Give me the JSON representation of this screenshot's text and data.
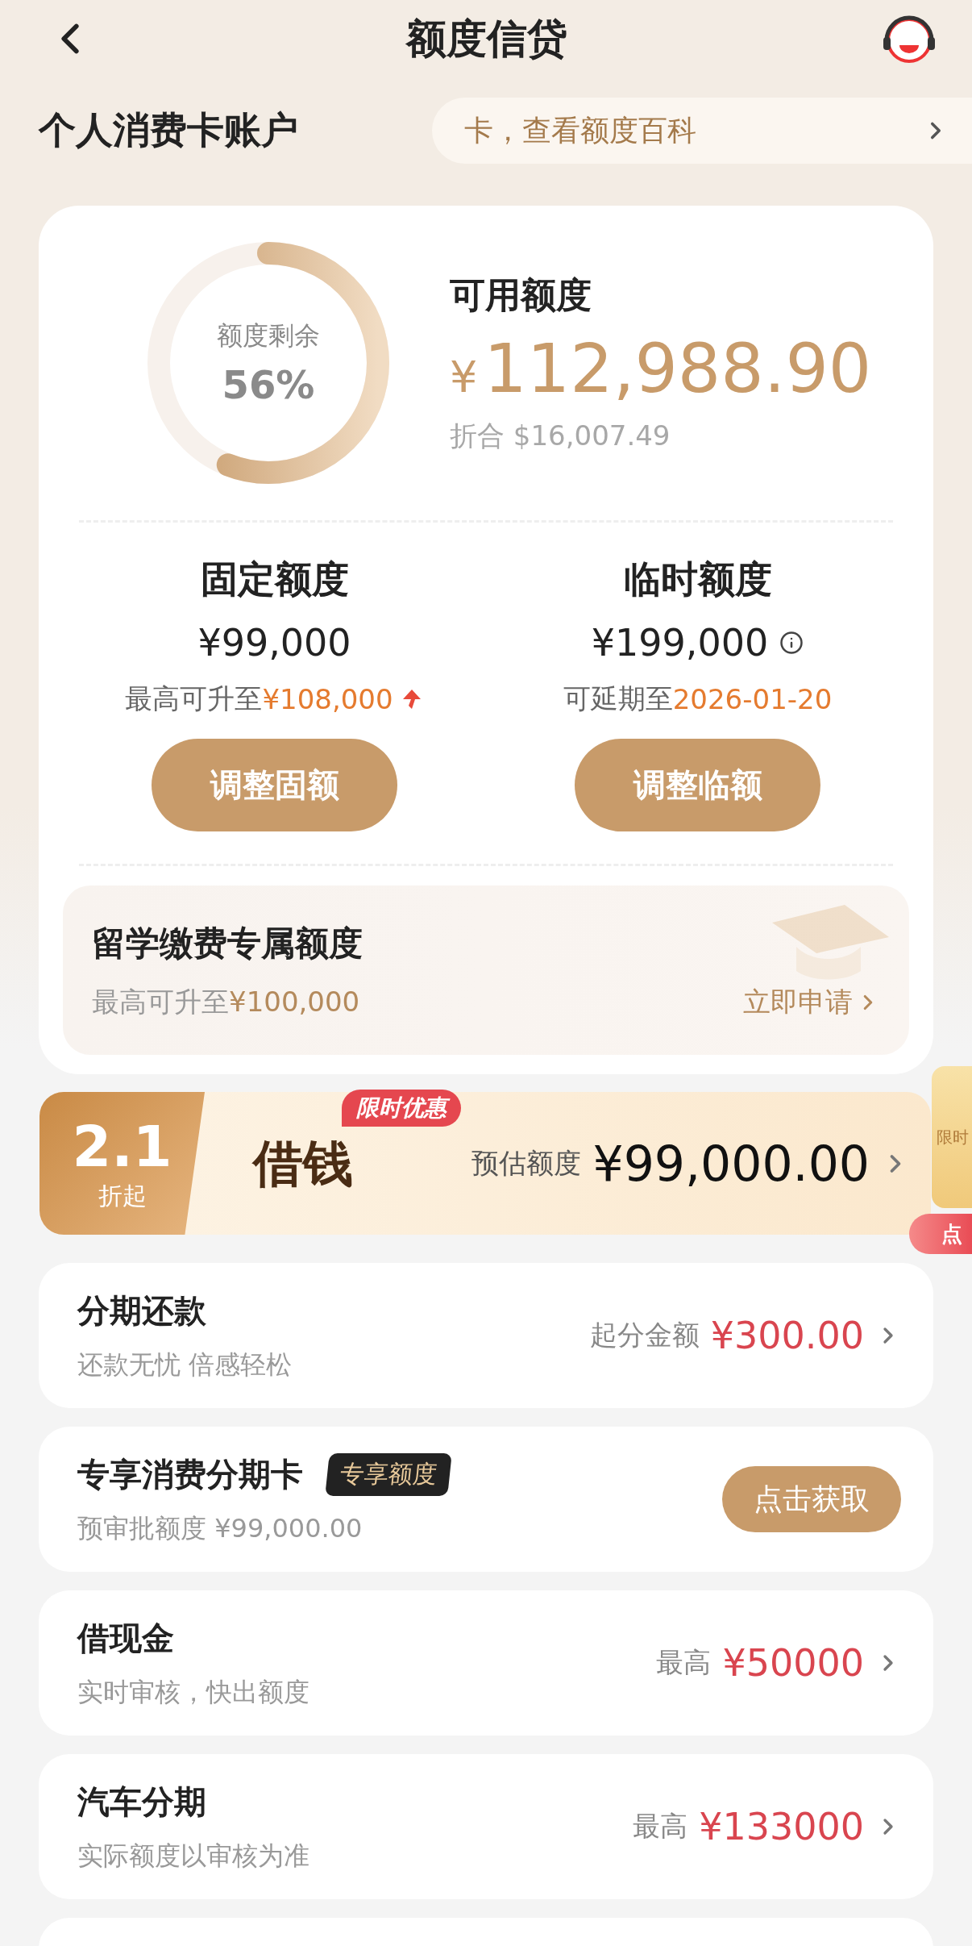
{
  "header": {
    "title": "额度信贷"
  },
  "account": {
    "title": "个人消费卡账户",
    "notice": "卡，查看额度百科"
  },
  "summary": {
    "ring_label": "额度剩余",
    "ring_value": "56%",
    "title": "可用额度",
    "currency": "¥",
    "amount": "112,988.90",
    "converted_label": "折合",
    "converted_value": "$16,007.49"
  },
  "limits": [
    {
      "title": "固定额度",
      "value": "¥99,000",
      "info": false,
      "note_label": "最高可升至",
      "note_value": "¥108,000",
      "rising": true,
      "button": "调整固额"
    },
    {
      "title": "临时额度",
      "value": "¥199,000",
      "info": true,
      "note_label": "可延期至",
      "note_value": "2026-01-20",
      "rising": false,
      "button": "调整临额"
    }
  ],
  "study": {
    "title": "留学缴费专属额度",
    "note_label": "最高可升至",
    "note_value": "¥100,000",
    "action": "立即申请"
  },
  "loan_banner": {
    "rate": "2.1",
    "rate_unit": "折起",
    "title": "借钱",
    "tag": "限时优惠",
    "label": "预估额度",
    "amount": "¥99,000.00"
  },
  "products": [
    {
      "kind": "link",
      "title": "分期还款",
      "subtitle": "还款无忧 倍感轻松",
      "label": "起分金额",
      "value": "¥300.00"
    },
    {
      "kind": "button",
      "title": "专享消费分期卡",
      "badge": "专享额度",
      "subtitle": "预审批额度 ¥99,000.00",
      "button": "点击获取"
    },
    {
      "kind": "link",
      "title": "借现金",
      "subtitle": "实时审核，快出额度",
      "label": "最高",
      "value": "¥50000"
    },
    {
      "kind": "link",
      "title": "汽车分期",
      "subtitle": "实际额度以审核为准",
      "label": "最高",
      "value": "¥133000"
    }
  ],
  "floating_ad": {
    "label": "限时",
    "button": "点"
  }
}
